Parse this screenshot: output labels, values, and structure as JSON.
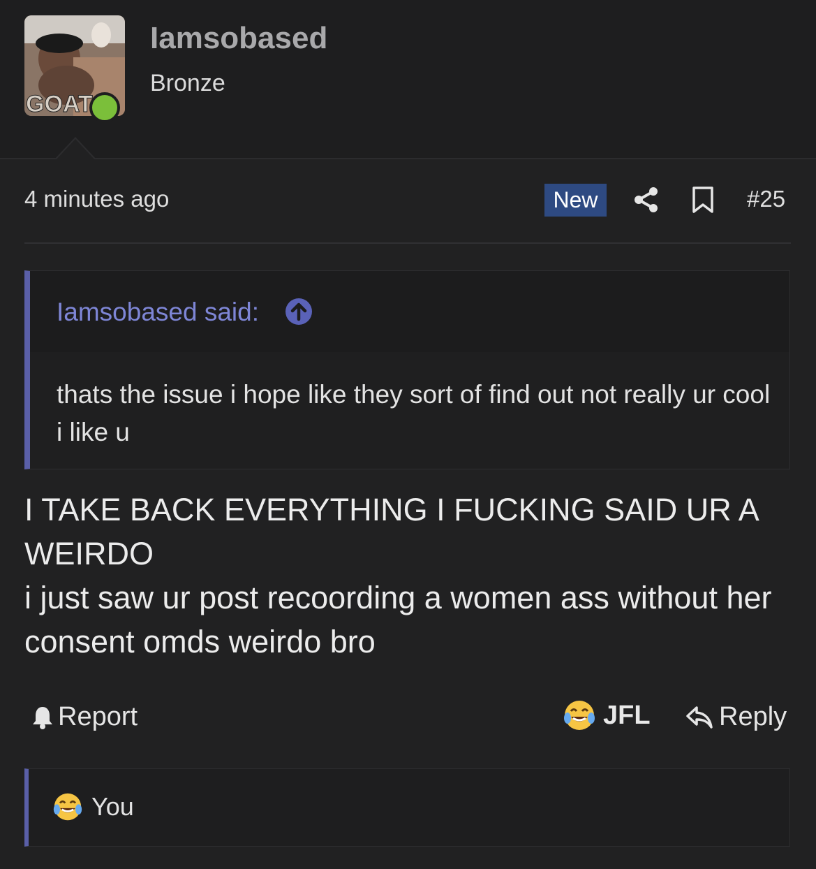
{
  "user": {
    "avatar_caption": "GOAT",
    "username": "Iamsobased",
    "rank": "Bronze",
    "online": true
  },
  "meta": {
    "time": "4 minutes ago",
    "badge": "New",
    "post_number": "#25",
    "share_icon": "share-icon",
    "bookmark_icon": "bookmark-icon"
  },
  "quote": {
    "author_label": "Iamsobased said:",
    "jump_icon": "arrow-up-circle-icon",
    "body": "thats the issue i hope like they sort of find out not really ur cool i like u"
  },
  "message": {
    "line1": "I TAKE BACK EVERYTHING I FUCKING SAID UR A WEIRDO",
    "line2": "i just saw ur post recoording a women ass without her consent omds weirdo bro"
  },
  "actions": {
    "report": "Report",
    "jfl": "JFL",
    "reply": "Reply"
  },
  "reactions": {
    "label": "You",
    "emoji": "crying-laughing-emoji"
  },
  "colors": {
    "accent": "#5a5fa8",
    "quote_author": "#7e86d6",
    "badge_bg": "#2e4a82",
    "online": "#7bbf3a",
    "background": "#212122"
  }
}
